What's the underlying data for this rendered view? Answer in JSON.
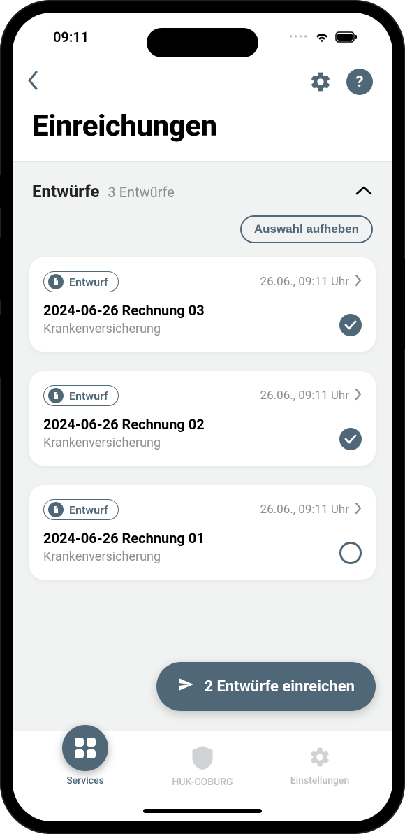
{
  "status": {
    "time": "09:11"
  },
  "page": {
    "title": "Einreichungen"
  },
  "section": {
    "title": "Entwürfe",
    "count_label": "3 Entwürfe",
    "clear_selection": "Auswahl aufheben"
  },
  "drafts": [
    {
      "badge": "Entwurf",
      "date": "26.06., 09:11 Uhr",
      "title": "2024-06-26 Rechnung 03",
      "subtitle": "Krankenversicherung",
      "selected": true
    },
    {
      "badge": "Entwurf",
      "date": "26.06., 09:11 Uhr",
      "title": "2024-06-26 Rechnung 02",
      "subtitle": "Krankenversicherung",
      "selected": true
    },
    {
      "badge": "Entwurf",
      "date": "26.06., 09:11 Uhr",
      "title": "2024-06-26 Rechnung 01",
      "subtitle": "Krankenversicherung",
      "selected": false
    }
  ],
  "submit": {
    "label": "2 Entwürfe einreichen"
  },
  "tabs": {
    "services": "Services",
    "brand": "HUK-COBURG",
    "settings": "Einstellungen"
  }
}
